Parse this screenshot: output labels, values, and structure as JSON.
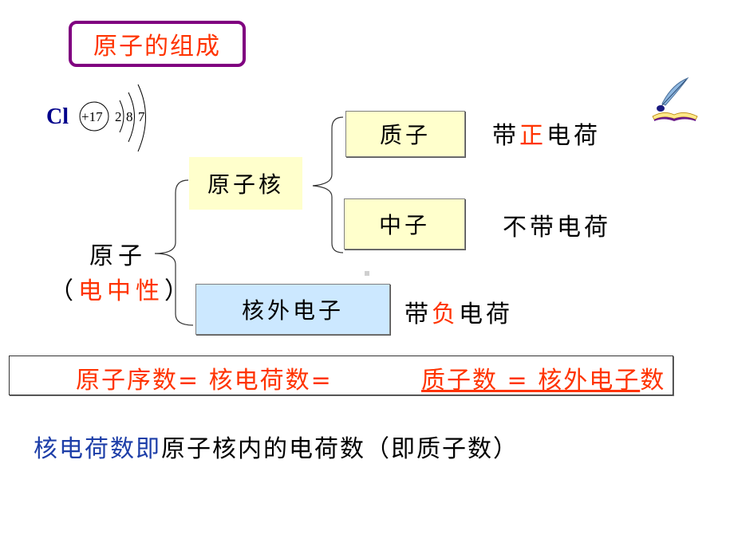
{
  "slide": {
    "title": "原子的组成",
    "chlorine_diagram": {
      "symbol": "Cl",
      "nucleus_charge": "+17",
      "shell_electrons": [
        "2",
        "8",
        "7"
      ]
    },
    "decoration_icon": "book-and-quill-icon",
    "atom": {
      "label": "原子",
      "paren_open": "（",
      "property": "电中性",
      "paren_close": "）"
    },
    "nucleus": {
      "label": "原子核"
    },
    "proton": {
      "label": "质子",
      "charge_prefix": "带",
      "charge_sign": "正",
      "charge_suffix": "电荷"
    },
    "neutron": {
      "label": "中子",
      "charge": "不带电荷"
    },
    "electron": {
      "label": "核外电子",
      "charge_prefix": "带",
      "charge_sign": "负",
      "charge_suffix": "电荷"
    },
    "equation": {
      "left": "原子序数= 核电荷数=",
      "right_underlined": "质子数 = 核外电子",
      "right_tail": "数"
    },
    "note": {
      "highlight": "核电荷数即",
      "rest": "原子核内的电荷数（即质子数）"
    },
    "colors": {
      "title_border": "#800080",
      "accent_red": "#ff3300",
      "accent_blue": "#1d3ea8",
      "box_yellow": "#ffffcc",
      "box_blue": "#cce8ff"
    }
  }
}
